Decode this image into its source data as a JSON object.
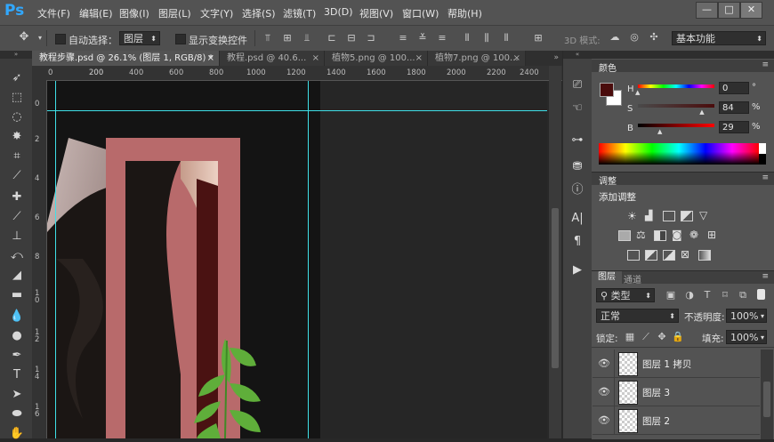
{
  "app": {
    "logo": "Ps"
  },
  "menu": [
    "文件(F)",
    "编辑(E)",
    "图像(I)",
    "图层(L)",
    "文字(Y)",
    "选择(S)",
    "滤镜(T)",
    "3D(D)",
    "视图(V)",
    "窗口(W)",
    "帮助(H)"
  ],
  "window_controls": {
    "minimize": "—",
    "maximize": "□",
    "close": "✕"
  },
  "options": {
    "auto_select_label": "自动选择：",
    "auto_select_value": "图层",
    "show_transform_label": "显示变换控件",
    "mode_label": "3D 模式:",
    "workspace": "基本功能"
  },
  "tabs": [
    {
      "label": "教程步骤.psd @ 26.1% (图层 1, RGB/8) *",
      "close": "×"
    },
    {
      "label": "教程.psd @ 40.6...",
      "close": "×"
    },
    {
      "label": "植物5.png @ 100...",
      "close": "×"
    },
    {
      "label": "植物7.png @ 100...",
      "close": "×"
    }
  ],
  "ruler_h": [
    "200",
    "0",
    "200",
    "400",
    "600",
    "800",
    "1000",
    "1200",
    "1400",
    "1600",
    "1800",
    "2000",
    "2200",
    "2400"
  ],
  "ruler_v": [
    "0",
    "2",
    "4",
    "6",
    "8",
    "1 0",
    "1 2",
    "1 4",
    "1 6",
    "1 8"
  ],
  "color_panel": {
    "title": "颜色",
    "h_label": "H",
    "h_value": "0",
    "h_unit": "°",
    "h_level": 0,
    "s_label": "S",
    "s_value": "84",
    "s_unit": "%",
    "s_level": 0.84,
    "b_label": "B",
    "b_value": "29",
    "b_unit": "%",
    "b_level": 0.29,
    "fg_color": "#4a0c0c",
    "bg_color": "#ffffff"
  },
  "adjust_panel": {
    "title": "调整",
    "add_label": "添加调整"
  },
  "layers_panel": {
    "tab_layers": "图层",
    "tab_channels": "通道",
    "kind_filter": "类型",
    "blend_mode": "正常",
    "opacity_label": "不透明度:",
    "opacity_value": "100%",
    "lock_label": "锁定:",
    "fill_label": "填充:",
    "fill_value": "100%",
    "layers": [
      {
        "name": "图层 1 拷贝"
      },
      {
        "name": "图层 3"
      },
      {
        "name": "图层 2"
      }
    ]
  },
  "colors": {
    "accent": "#31a8ff",
    "frame": "#b86a6b",
    "guide": "#3fe0e8"
  }
}
